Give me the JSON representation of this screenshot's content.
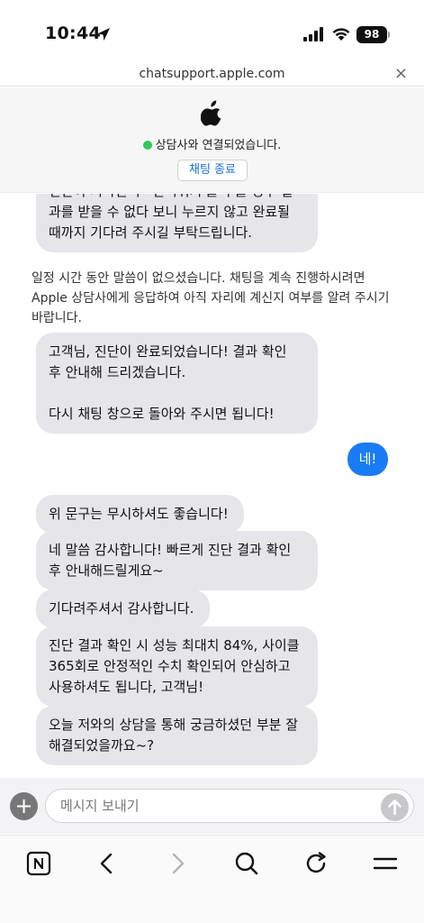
{
  "status_bar": {
    "time": "10:44",
    "battery": "98"
  },
  "url_bar": {
    "domain": "chatsupport.apple.com",
    "close": "×"
  },
  "header": {
    "status": "상담사와 연결되었습니다.",
    "end_chat": "채팅 종료"
  },
  "messages": [
    {
      "from": "agent",
      "text": "진단이 시작된 후 '건너뛰기'를 누를 경우 결\n과를 받을 수 없다 보니 누르지 않고 완료될\n때까지 기다려 주시길 부탁드립니다."
    },
    {
      "from": "system",
      "text": "일정 시간 동안 말씀이 없으셨습니다. 채팅을 계속 진행하시려면 Apple 상담사에게 응답하여 아직 자리에 계신지 여부를 알려 주시기 바랍니다."
    },
    {
      "from": "agent",
      "text": "고객님, 진단이 완료되었습니다! 결과 확인\n후 안내해 드리겠습니다.\n\n다시 채팅 창으로 돌아와 주시면 됩니다!"
    },
    {
      "from": "user",
      "text": "네!"
    },
    {
      "from": "agent",
      "text": "위 문구는 무시하셔도 좋습니다!"
    },
    {
      "from": "agent",
      "text": "네 말씀 감사합니다! 빠르게 진단 결과 확인\n후 안내해드릴게요~"
    },
    {
      "from": "agent",
      "text": "기다려주셔서 감사합니다."
    },
    {
      "from": "agent",
      "text": "진단 결과 확인 시 성능 최대치 84%, 사이클\n365회로 안정적인 수치 확인되어 안심하고\n사용하셔도 됩니다, 고객님!"
    },
    {
      "from": "agent",
      "text": "오늘 저와의 상담을 통해 궁금하셨던 부분 잘\n해결되었을까요~?"
    }
  ],
  "composer": {
    "placeholder": "메시지 보내기",
    "plus": "+"
  },
  "colors": {
    "accent": "#1a7cf4",
    "agent_bubble": "#e6e6ea",
    "online": "#34c759"
  },
  "icons": [
    "location-arrow-icon",
    "signal-icon",
    "wifi-icon",
    "apple-logo-icon",
    "send-arrow-icon",
    "naver-n-icon",
    "back-icon",
    "forward-icon",
    "search-icon",
    "refresh-icon",
    "menu-icon"
  ]
}
